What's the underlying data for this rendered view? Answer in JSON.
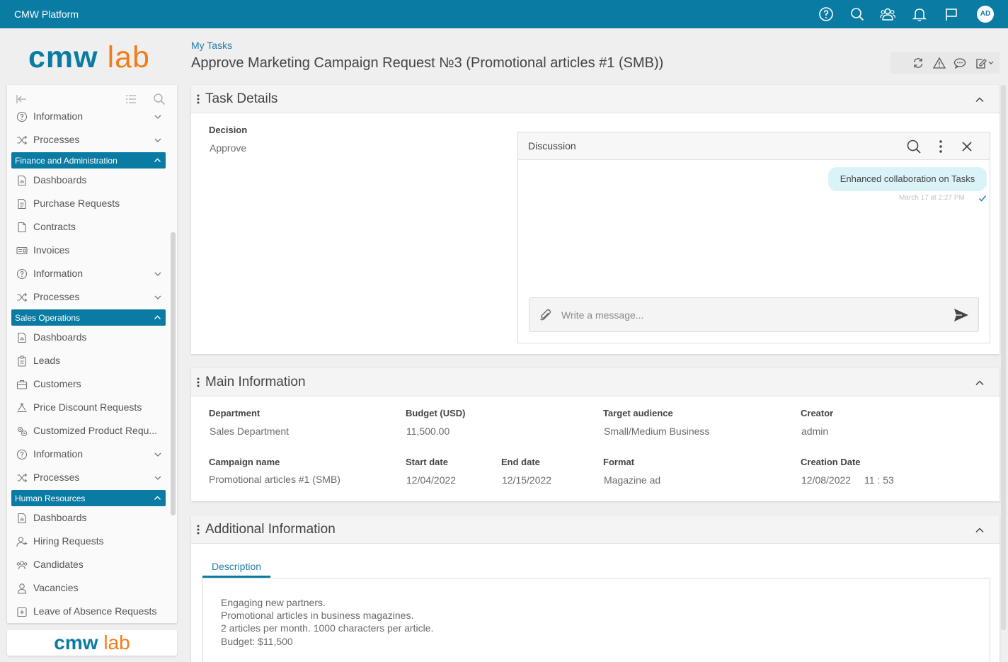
{
  "app": {
    "title": "CMW Platform",
    "user_initials": "AD"
  },
  "logo": {
    "part1": "cmw",
    "part2": "lab"
  },
  "topbar_icons": [
    "help-icon",
    "search-icon",
    "users-icon",
    "bell-icon",
    "flag-icon"
  ],
  "header": {
    "breadcrumb": "My Tasks",
    "title": "Approve Marketing Campaign Request №3 (Promotional articles #1 (SMB))",
    "toolbar_icons": [
      "refresh-icon",
      "warning-icon",
      "chat-icon",
      "edit-icon"
    ]
  },
  "sidebar": {
    "items": [
      {
        "type": "item",
        "label": "Information",
        "icon": "info-icon",
        "chevron": true
      },
      {
        "type": "item",
        "label": "Processes",
        "icon": "shuffle-icon",
        "chevron": true
      },
      {
        "type": "group",
        "label": "Finance and Administration"
      },
      {
        "type": "item",
        "label": "Dashboards",
        "icon": "dashboard-icon"
      },
      {
        "type": "item",
        "label": "Purchase Requests",
        "icon": "document-icon"
      },
      {
        "type": "item",
        "label": "Contracts",
        "icon": "page-icon"
      },
      {
        "type": "item",
        "label": "Invoices",
        "icon": "invoice-icon"
      },
      {
        "type": "item",
        "label": "Information",
        "icon": "info-icon",
        "chevron": true
      },
      {
        "type": "item",
        "label": "Processes",
        "icon": "shuffle-icon",
        "chevron": true
      },
      {
        "type": "group",
        "label": "Sales Operations"
      },
      {
        "type": "item",
        "label": "Dashboards",
        "icon": "dashboard-icon"
      },
      {
        "type": "item",
        "label": "Leads",
        "icon": "clipboard-icon"
      },
      {
        "type": "item",
        "label": "Customers",
        "icon": "briefcase-icon"
      },
      {
        "type": "item",
        "label": "Price Discount Requests",
        "icon": "discount-icon"
      },
      {
        "type": "item",
        "label": "Customized Product Requ...",
        "icon": "gears-icon"
      },
      {
        "type": "item",
        "label": "Information",
        "icon": "info-icon",
        "chevron": true
      },
      {
        "type": "item",
        "label": "Processes",
        "icon": "shuffle-icon",
        "chevron": true
      },
      {
        "type": "group",
        "label": "Human Resources"
      },
      {
        "type": "item",
        "label": "Dashboards",
        "icon": "dashboard-icon"
      },
      {
        "type": "item",
        "label": "Hiring Requests",
        "icon": "user-plus-icon"
      },
      {
        "type": "item",
        "label": "Candidates",
        "icon": "group-icon"
      },
      {
        "type": "item",
        "label": "Vacancies",
        "icon": "user-icon"
      },
      {
        "type": "item",
        "label": "Leave of Absence Requests",
        "icon": "leave-icon"
      }
    ]
  },
  "task_details": {
    "title": "Task Details",
    "decision_label": "Decision",
    "decision_value": "Approve",
    "discussion": {
      "title": "Discussion",
      "message": "Enhanced collaboration on Tasks",
      "time": "March 17 at 2:27 PM",
      "input_placeholder": "Write a message..."
    }
  },
  "main_info": {
    "title": "Main Information",
    "fields": [
      {
        "label": "Department",
        "value": "Sales Department"
      },
      {
        "label": "Budget (USD)",
        "value": "11,500.00"
      },
      {
        "label": "Target audience",
        "value": "Small/Medium Business"
      },
      {
        "label": "Creator",
        "value": "admin"
      },
      {
        "label": "Campaign name",
        "value": "Promotional articles #1 (SMB)"
      },
      {
        "label": "Start date",
        "value": "12/04/2022"
      },
      {
        "label": "End date",
        "value": "12/15/2022"
      },
      {
        "label": "Format",
        "value": "Magazine ad"
      },
      {
        "label": "Creation Date",
        "value": "12/08/2022",
        "time": "11 : 53"
      }
    ]
  },
  "additional_info": {
    "title": "Additional Information",
    "tab_label": "Description",
    "description_lines": [
      "Engaging new partners.",
      "Promotional articles in business magazines.",
      "2 articles per month. 1000 characters per article.",
      "Budget: $11,500"
    ]
  },
  "colors": {
    "brand": "#0a7ba3",
    "logo_accent": "#f07d1a",
    "bubble": "#daf3f8"
  }
}
